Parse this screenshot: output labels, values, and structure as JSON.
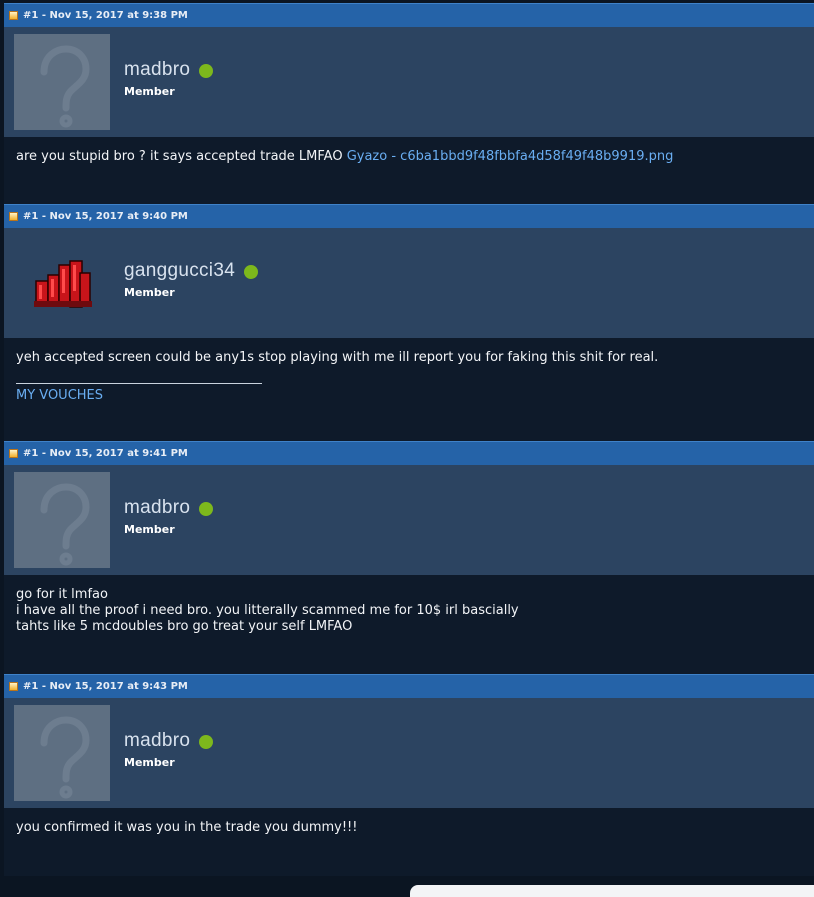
{
  "posts": [
    {
      "header": "#1 - Nov 15, 2017 at 9:38 PM",
      "username": "madbro",
      "user_title": "Member",
      "avatar": "default-avatar",
      "body_lines": [
        "are you stupid bro ? it says accepted trade LMFAO "
      ],
      "link_text": "Gyazo - c6ba1bbd9f48fbbfa4d58f49f48b9919.png"
    },
    {
      "header": "#1 - Nov 15, 2017 at 9:40 PM",
      "username": "ganggucci34",
      "user_title": "Member",
      "avatar": "red-hand-avatar",
      "body_lines": [
        "yeh accepted screen could be any1s stop playing with me ill report you for faking this shit for real."
      ],
      "signature_link": "MY VOUCHES"
    },
    {
      "header": "#1 - Nov 15, 2017 at 9:41 PM",
      "username": "madbro",
      "user_title": "Member",
      "avatar": "default-avatar",
      "body_lines": [
        "go for it lmfao",
        "i have all the proof i need bro. you litterally scammed me for 10$ irl bascially",
        "tahts like 5 mcdoubles bro go treat your self LMFAO"
      ]
    },
    {
      "header": "#1 - Nov 15, 2017 at 9:43 PM",
      "username": "madbro",
      "user_title": "Member",
      "avatar": "default-avatar",
      "body_lines": [
        "you confirmed it was you in the trade you dummy!!!"
      ]
    }
  ],
  "colors": {
    "header_bar": "#2563a8",
    "user_panel": "#2c4461",
    "body_bg": "#0e1a2a",
    "online": "#7db81c",
    "link": "#6aaef2"
  }
}
